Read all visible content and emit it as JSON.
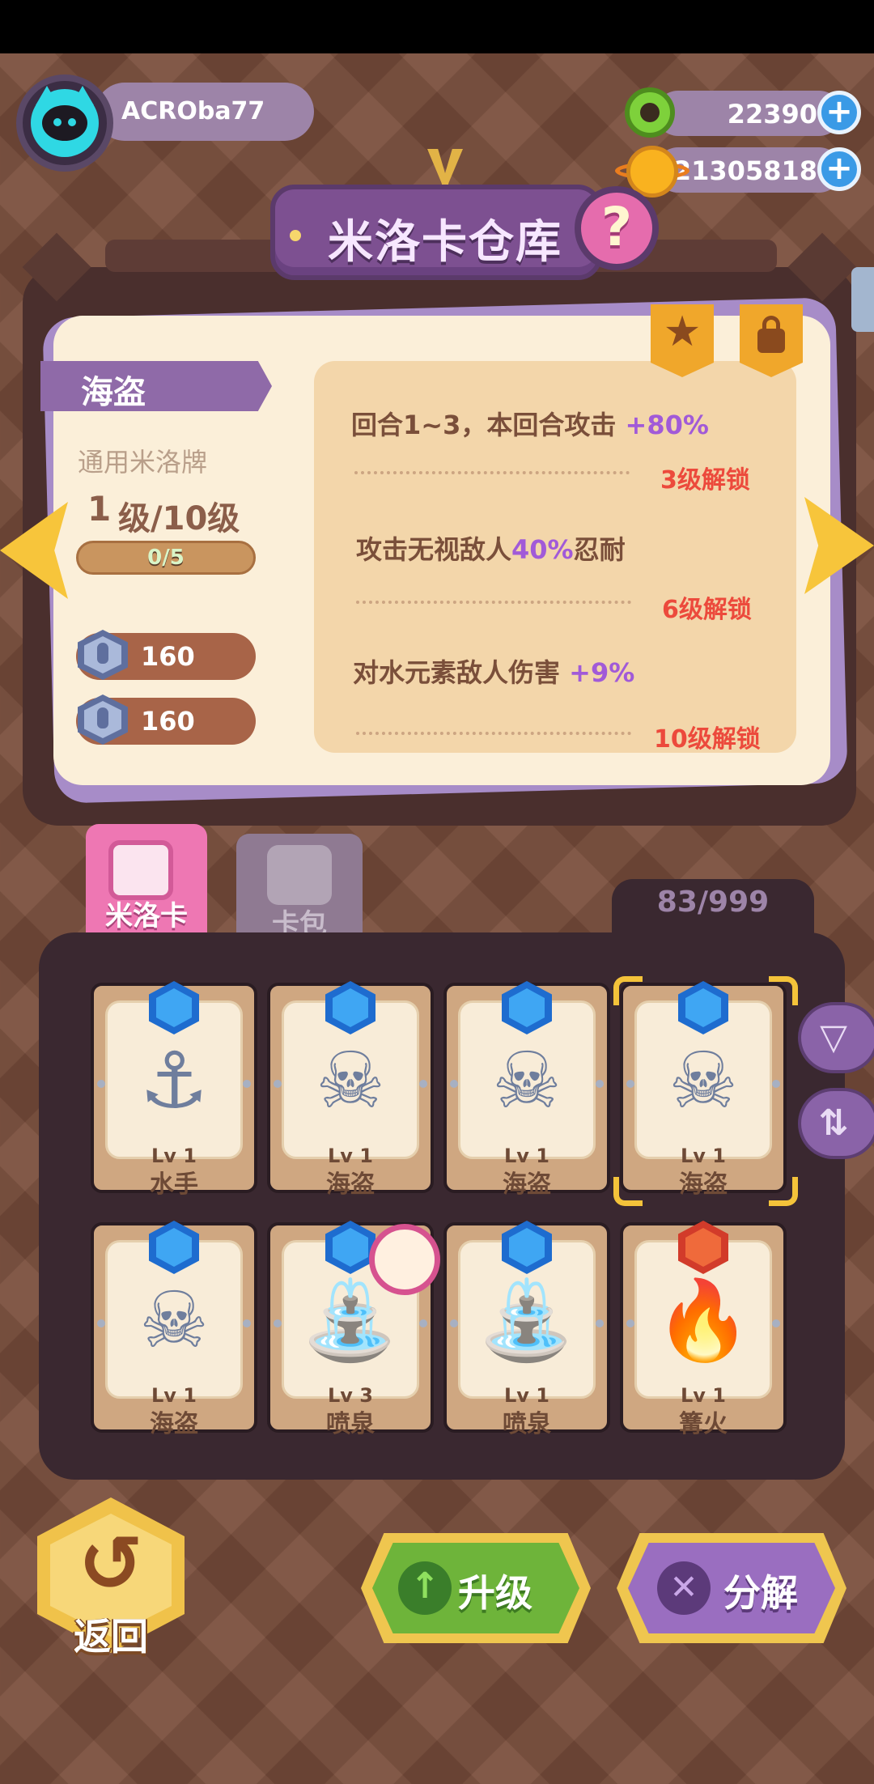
{
  "player": {
    "name": "ACROba77"
  },
  "currencies": [
    {
      "name": "green-coin",
      "value": "22390"
    },
    {
      "name": "gold-coin",
      "value": "21305818"
    }
  ],
  "title": "米洛卡仓库",
  "help_glyph": "?",
  "card_detail": {
    "name": "海盗",
    "type": "通用米洛牌",
    "level_current": "1",
    "level_label": "级/10级",
    "xp_text": "0/5",
    "xp_fraction": 0,
    "costs": [
      "160",
      "160"
    ]
  },
  "skills": [
    {
      "text_before": "回合1~3，本回合攻击 ",
      "highlight": "+80%",
      "text_after": "",
      "unlock": "3级解锁"
    },
    {
      "text_before": "攻击无视敌人",
      "highlight": "40%",
      "text_after": "忍耐",
      "unlock": "6级解锁"
    },
    {
      "text_before": "对水元素敌人伤害 ",
      "highlight": "+9%",
      "text_after": "",
      "unlock": "10级解锁"
    }
  ],
  "tabs": {
    "milo": "米洛卡",
    "pack": "卡包"
  },
  "inventory_count": "83/999",
  "cards": [
    {
      "lv": "Lv 1",
      "name": "水手",
      "icon": "anchor-icon",
      "glyph": "⚓",
      "badge": "blue"
    },
    {
      "lv": "Lv 1",
      "name": "海盗",
      "icon": "pirate-skull-icon",
      "glyph": "☠",
      "badge": "blue"
    },
    {
      "lv": "Lv 1",
      "name": "海盗",
      "icon": "pirate-skull-icon",
      "glyph": "☠",
      "badge": "blue"
    },
    {
      "lv": "Lv 1",
      "name": "海盗",
      "icon": "pirate-skull-icon",
      "glyph": "☠",
      "badge": "blue"
    },
    {
      "lv": "Lv 1",
      "name": "海盗",
      "icon": "pirate-skull-icon",
      "glyph": "☠",
      "badge": "blue"
    },
    {
      "lv": "Lv 3",
      "name": "喷泉",
      "icon": "fountain-icon",
      "glyph": "⛲",
      "badge": "blue"
    },
    {
      "lv": "Lv 1",
      "name": "喷泉",
      "icon": "fountain-icon",
      "glyph": "⛲",
      "badge": "blue"
    },
    {
      "lv": "Lv 1",
      "name": "篝火",
      "icon": "campfire-icon",
      "glyph": "🔥",
      "badge": "red"
    }
  ],
  "buttons": {
    "back": "返回",
    "upgrade": "升级",
    "decompose": "分解"
  },
  "icons": {
    "plus": "+",
    "left_arrow": "chevron-left-icon",
    "right_arrow": "chevron-right-icon",
    "filter": "filter-icon",
    "sort": "sort-icon",
    "back_glyph": "↺",
    "upgrade_glyph": "↑",
    "decompose_glyph": "✕",
    "star_glyph": "★"
  },
  "colors": {
    "accent_purple": "#9d84a8",
    "highlight": "#a15ad8",
    "unlock_red": "#ec4a3c"
  }
}
